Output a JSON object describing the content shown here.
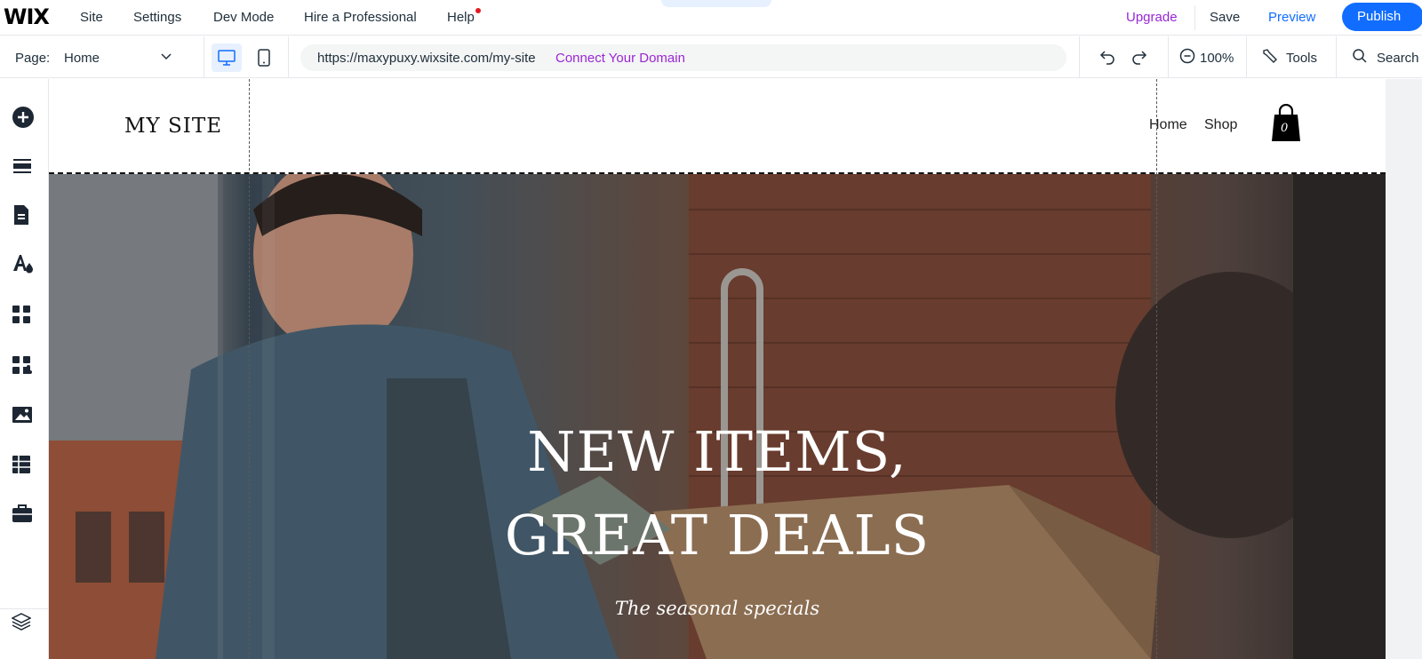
{
  "topbar": {
    "logo": "WIX",
    "menu": [
      "Site",
      "Settings",
      "Dev Mode",
      "Hire a Professional",
      "Help"
    ],
    "upgrade": "Upgrade",
    "save": "Save",
    "preview": "Preview",
    "publish": "Publish",
    "colors": {
      "upgrade": "#9a27d5",
      "preview": "#116dff",
      "publish_bg": "#116dff",
      "help_dot": "#e21c21"
    }
  },
  "subbar": {
    "page_label": "Page:",
    "page_value": "Home",
    "url": "https://maxypuxy.wixsite.com/my-site",
    "connect_domain": "Connect Your Domain",
    "zoom": "100%",
    "tools": "Tools",
    "search": "Search",
    "icons": [
      "chevron-down-icon",
      "desktop-icon",
      "mobile-icon",
      "undo-icon",
      "redo-icon",
      "zoom-out-icon",
      "tools-icon",
      "search-icon"
    ]
  },
  "sidebar": {
    "icons": [
      "add-elements-icon",
      "sections-icon",
      "pages-icon",
      "site-design-icon",
      "apps-icon",
      "add-apps-icon",
      "media-icon",
      "cms-icon",
      "business-tools-icon",
      "layers-icon"
    ]
  },
  "site": {
    "title": "MY SITE",
    "nav": [
      "Home",
      "Shop"
    ],
    "cart_count": "0",
    "hero_line1": "NEW ITEMS,",
    "hero_line2": "GREAT DEALS",
    "hero_sub": "The seasonal specials"
  }
}
